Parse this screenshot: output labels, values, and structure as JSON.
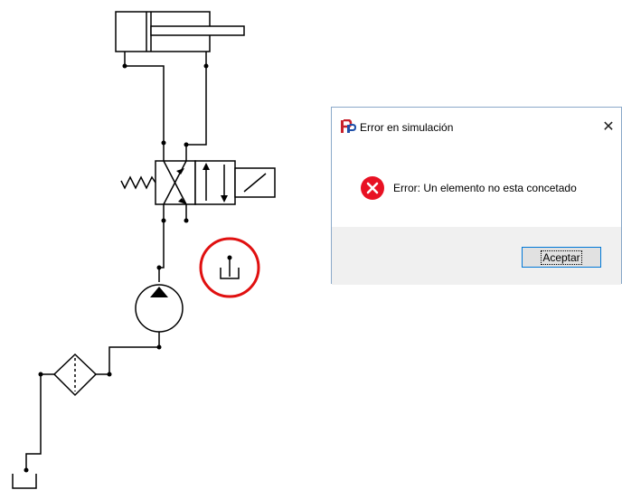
{
  "dialog": {
    "title": "Error en simulación",
    "close_label": "✕",
    "message": "Error: Un elemento no esta concetado",
    "accept_label": "Aceptar",
    "app_icon": "app-logo-icon",
    "message_icon": "error-icon"
  },
  "diagram": {
    "components": [
      "double-acting-cylinder",
      "4/2-directional-valve",
      "spring",
      "solenoid",
      "pump",
      "filter",
      "tank",
      "unconnected-tank"
    ],
    "highlight_color": "#e01010"
  },
  "colors": {
    "error_icon": "#e81123",
    "button_border": "#0078d7",
    "dialog_footer": "#f0f0f0"
  }
}
